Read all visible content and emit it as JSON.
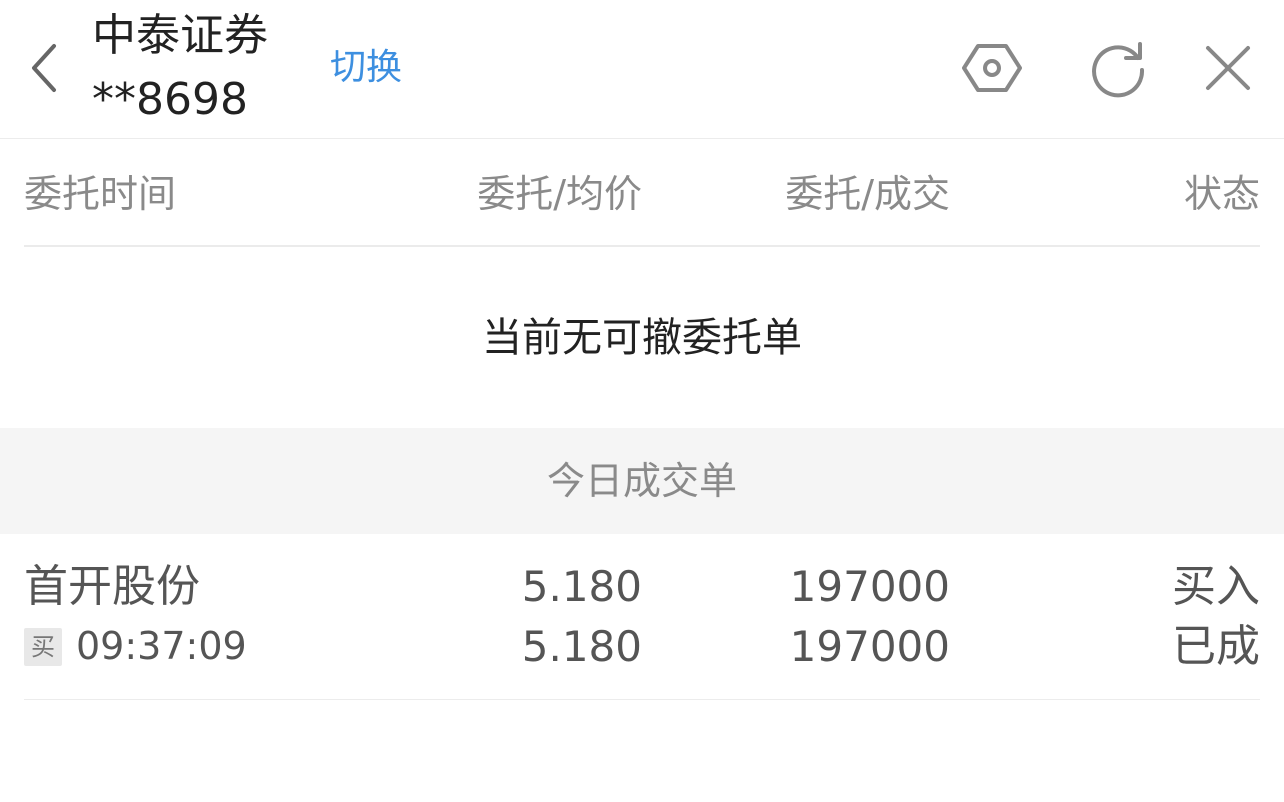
{
  "header": {
    "broker_name": "中泰证券",
    "account": "**8698",
    "switch_label": "切换",
    "icons": [
      "back-icon",
      "settings-hexagon-icon",
      "refresh-icon",
      "close-icon"
    ]
  },
  "columns": {
    "time": "委托时间",
    "price": "委托/均价",
    "qty": "委托/成交",
    "status": "状态"
  },
  "pending": {
    "empty_message": "当前无可撤委托单"
  },
  "today_trades": {
    "section_title": "今日成交单",
    "rows": [
      {
        "name": "首开股份",
        "side_badge": "买",
        "time": "09:37:09",
        "order_price": "5.180",
        "avg_price": "5.180",
        "order_qty": "197000",
        "filled_qty": "197000",
        "direction": "买入",
        "status": "已成"
      }
    ]
  },
  "colors": {
    "link": "#3d8fe0",
    "muted_text": "#8a8a8a",
    "section_bg": "#f5f5f5"
  }
}
